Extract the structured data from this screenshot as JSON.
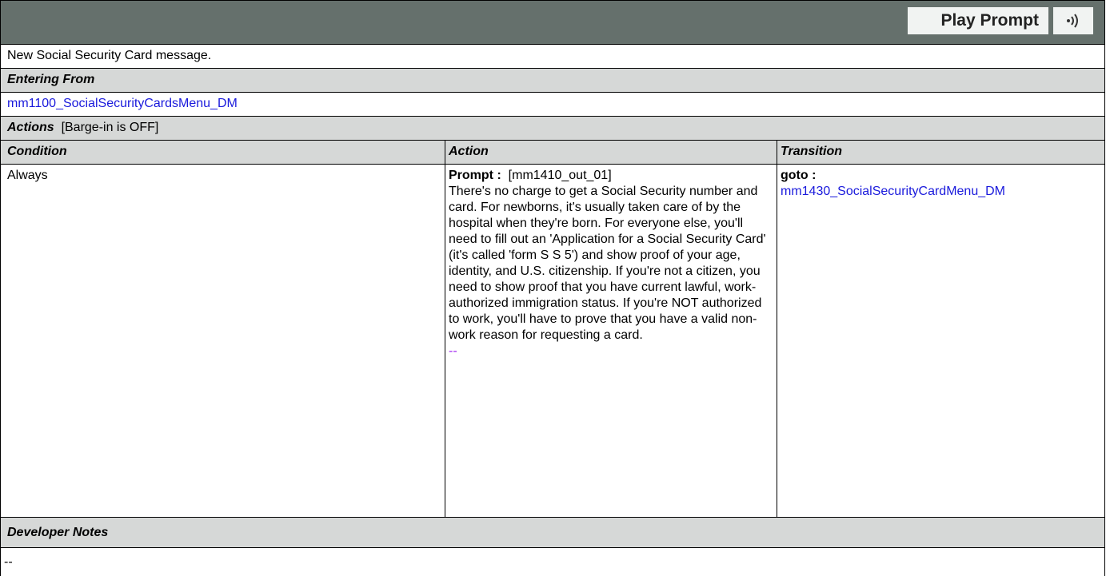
{
  "header": {
    "play_prompt_label": "Play Prompt",
    "icon": "speaker-sound-icon"
  },
  "description": "New Social Security Card message.",
  "entering_from": {
    "label": "Entering From",
    "link": "mm1100_SocialSecurityCardsMenu_DM"
  },
  "actions": {
    "label": "Actions",
    "barge_in": "[Barge-in is OFF]",
    "columns": {
      "condition": "Condition",
      "action": "Action",
      "transition": "Transition"
    },
    "row": {
      "condition": "Always",
      "prompt_label": "Prompt :",
      "prompt_id": "[mm1410_out_01]",
      "prompt_text": "There's no charge to get a Social Security number and card. For newborns, it's usually taken care of by the hospital when they're born. For everyone else, you'll need to fill out an 'Application for a Social Security Card' (it's called 'form S S 5') and show proof of your age, identity, and U.S. citizenship. If you're not a citizen, you need to show proof that you have current lawful, work-authorized immigration status. If you're NOT authorized to work, you'll have to prove that you have a valid non-work reason for requesting a card.",
      "prompt_link": "--",
      "goto_label": "goto :",
      "goto_target": "mm1430_SocialSecurityCardMenu_DM"
    }
  },
  "developer_notes": {
    "label": "Developer Notes",
    "value": "--"
  },
  "colors": {
    "header_bg": "#65706c",
    "section_bg": "#d6d8d7",
    "link": "#1a1adc",
    "purple": "#a020f0"
  }
}
